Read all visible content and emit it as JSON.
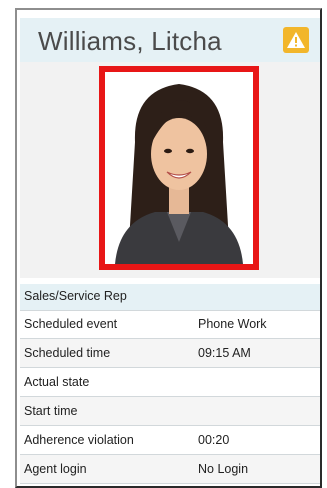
{
  "agent": {
    "name": "Williams, Litcha",
    "warning_icon": "warning-triangle-icon",
    "photo": "agent-photo",
    "role": "Sales/Service Rep"
  },
  "details": [
    {
      "label": "Scheduled event",
      "value": "Phone Work"
    },
    {
      "label": "Scheduled time",
      "value": "09:15 AM"
    },
    {
      "label": "Actual state",
      "value": ""
    },
    {
      "label": "Start time",
      "value": ""
    },
    {
      "label": "Adherence violation",
      "value": "00:20"
    },
    {
      "label": "Agent login",
      "value": "No Login"
    }
  ],
  "colors": {
    "header_bg": "#e5f1f5",
    "warning": "#f2b62b",
    "photo_border": "#e81616"
  }
}
